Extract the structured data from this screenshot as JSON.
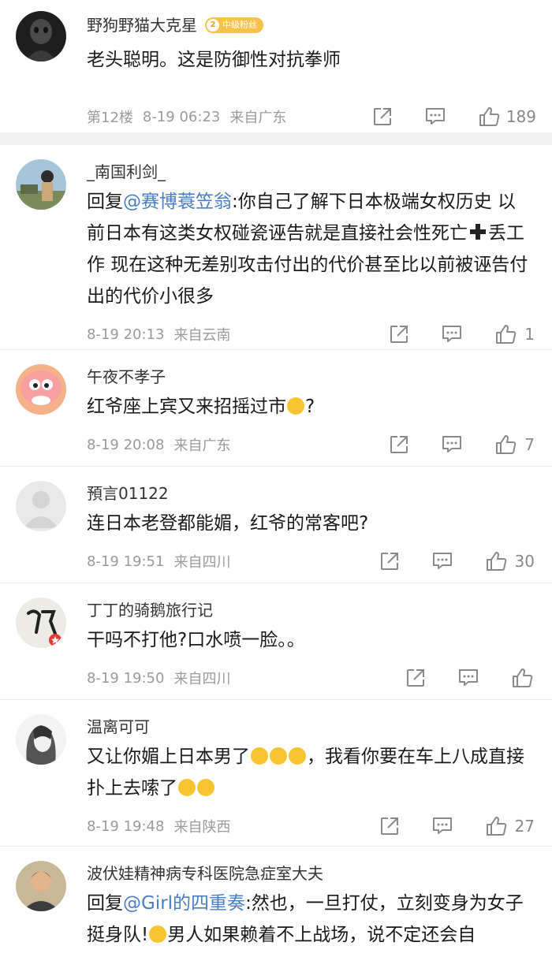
{
  "comments": [
    {
      "username": "野狗野猫大克星",
      "badge": {
        "level": "2",
        "label": "中级粉丝"
      },
      "text": "老头聪明。这是防御性对抗拳师",
      "floor": "第12楼",
      "time": "8-19 06:23",
      "location": "来自广东",
      "likes": "189"
    },
    {
      "username": "_南国利剑_",
      "reply_prefix": "回复",
      "mention": "@赛博蓑笠翁",
      "text": ":你自己了解下日本极端女权历史 以前日本有这类女权碰瓷诬告就是直接社会性死亡",
      "text2": "丢工作 现在这种无差别攻击付出的代价甚至比以前被诬告付出的代价小很多",
      "time": "8-19 20:13",
      "location": "来自云南",
      "likes": "1"
    },
    {
      "username": "午夜不孝子",
      "text": "红爷座上宾又来招摇过市",
      "text2": "?",
      "time": "8-19 20:08",
      "location": "来自广东",
      "likes": "7"
    },
    {
      "username": "預言01122",
      "text": "连日本老登都能媚，红爷的常客吧?",
      "time": "8-19 19:51",
      "location": "来自四川",
      "likes": "30"
    },
    {
      "username": "丁丁的骑鹅旅行记",
      "text": "干吗不打他?口水喷一脸。。",
      "time": "8-19 19:50",
      "location": "来自四川",
      "likes": ""
    },
    {
      "username": "温离可可",
      "text": "又让你媚上日本男了",
      "text2": "，我看你要在车上八成直接扑上去嗦了",
      "time": "8-19 19:48",
      "location": "来自陕西",
      "likes": "27"
    },
    {
      "username": "波伏娃精神病专科医院急症室大夫",
      "reply_prefix": "回复",
      "mention": "@Girl的四重奏",
      "text": ":然也，一旦打仗，立刻变身为女子挺身队!",
      "text2": "男人如果赖着不上战场，说不定还会自"
    }
  ],
  "colors": {
    "mention": "#4a7dc4",
    "meta": "#9a9a9a",
    "badge": "#f6c24a"
  },
  "icons": [
    "share-icon",
    "comment-icon",
    "thumbs-up-icon",
    "plus-emoji-icon"
  ]
}
